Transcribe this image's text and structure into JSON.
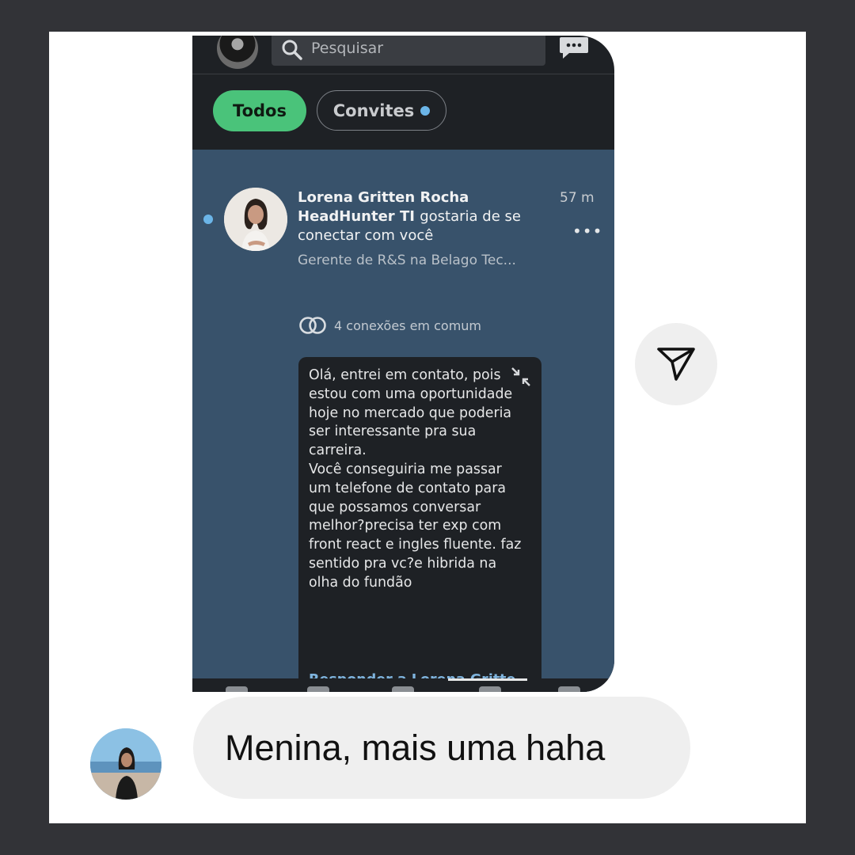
{
  "search": {
    "placeholder": "Pesquisar"
  },
  "filters": {
    "all": "Todos",
    "invites": "Convites"
  },
  "invitation": {
    "name": "Lorena Gritten Rocha",
    "title": "HeadHunter TI",
    "action": "gostaria de se conectar com você",
    "time": "57 m",
    "headline": "Gerente de R&S na Belago Tec...",
    "mutual": "4 conexões em comum",
    "message": "Olá, entrei em contato, pois estou com uma oportunidade hoje no mercado que poderia ser interessante pra sua carreira.\nVocê conseguiria me passar um telefone de contato para que possamos conversar melhor?precisa ter exp com front react e ingles fluente. faz sentido pra vc?e hibrida na olha do fundão",
    "reply": "Responder a Lorena Gritte..."
  },
  "chat": {
    "reply_text": "Menina, mais uma haha"
  },
  "icons": [
    "search-icon",
    "message-icon",
    "collapse-icon",
    "more-icon",
    "mutual-connections-icon",
    "send-icon"
  ],
  "colors": {
    "accent_green": "#4ac37a",
    "unread_blue": "#6bb5e8",
    "invite_bg": "#38526b",
    "link_blue": "#7fb4de"
  }
}
